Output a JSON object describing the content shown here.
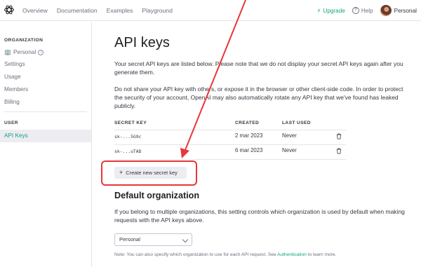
{
  "topbar": {
    "nav": [
      "Overview",
      "Documentation",
      "Examples",
      "Playground"
    ],
    "upgrade_label": "Upgrade",
    "help_label": "Help",
    "account_label": "Personal"
  },
  "sidebar": {
    "organization_title": "ORGANIZATION",
    "org_items": [
      "Personal",
      "Settings",
      "Usage",
      "Members",
      "Billing"
    ],
    "user_title": "USER",
    "active_item": "API Keys"
  },
  "main": {
    "title": "API keys",
    "intro": "Your secret API keys are listed below. Please note that we do not display your secret API keys again after you generate them.",
    "warning": "Do not share your API key with others, or expose it in the browser or other client-side code. In order to protect the security of your account, OpenAI may also automatically rotate any API key that we've found has leaked publicly.",
    "table": {
      "headers": [
        "SECRET KEY",
        "CREATED",
        "LAST USED"
      ],
      "rows": [
        {
          "key": "sk-...5G9c",
          "created": "2 mar 2023",
          "last_used": "Never"
        },
        {
          "key": "sk-...uTAD",
          "created": "6 mar 2023",
          "last_used": "Never"
        }
      ]
    },
    "create_button": "Create new secret key",
    "default_org_title": "Default organization",
    "default_org_text": "If you belong to multiple organizations, this setting controls which organization is used by default when making requests with the API keys above.",
    "select_value": "Personal",
    "note_prefix": "Note: You can also specify which organization to use for each API request. See ",
    "note_link": "Authentication",
    "note_suffix": " to learn more."
  },
  "colors": {
    "accent": "#10a37f",
    "annotation": "#e8363a"
  }
}
